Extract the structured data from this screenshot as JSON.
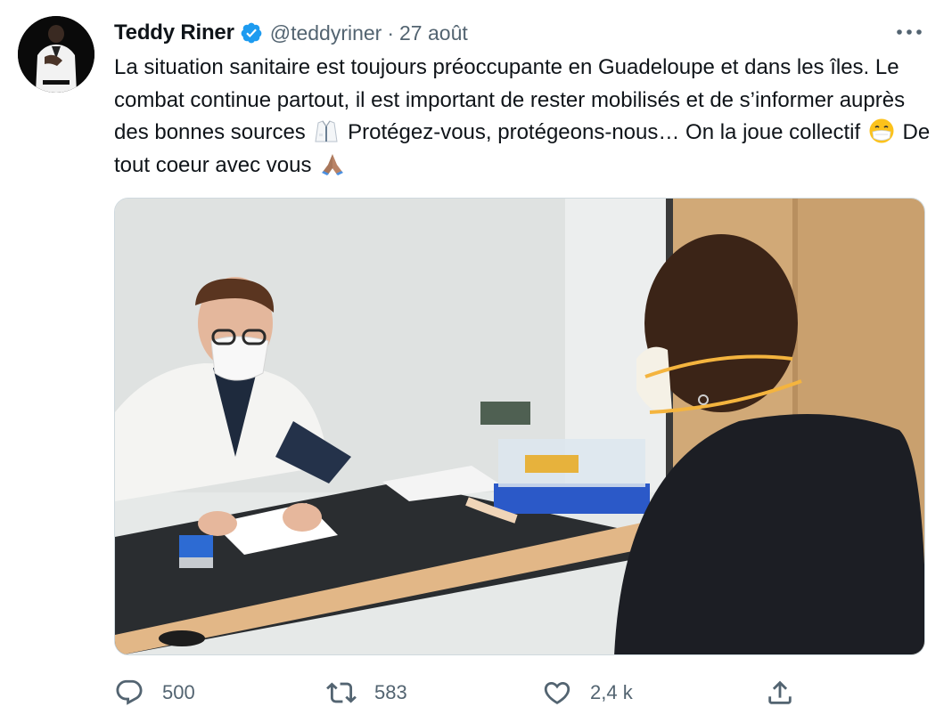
{
  "author": {
    "display_name": "Teddy Riner",
    "handle": "@teddyriner",
    "separator": "·",
    "date": "27 août",
    "verified": true
  },
  "tweet": {
    "text_part1": "La situation sanitaire est toujours préoccupante en Guadeloupe et dans les îles. Le combat continue partout, il est important de rester mobilisés et de s’informer auprès des bonnes sources",
    "text_part2": "Protégez-vous, protégeons-nous… On la joue collectif",
    "text_part3": "De tout coeur avec vous",
    "emojis": [
      "lab-coat-emoji",
      "face-with-mask-emoji",
      "folded-hands-emoji"
    ]
  },
  "actions": {
    "reply_count": "500",
    "retweet_count": "583",
    "like_count": "2,4 k"
  },
  "colors": {
    "text": "#0f1419",
    "secondary": "#536471",
    "verified": "#1d9bf0",
    "border": "#cfd9de"
  },
  "icons": [
    "more-icon",
    "verified-badge-icon",
    "reply-icon",
    "retweet-icon",
    "like-icon",
    "share-icon"
  ]
}
